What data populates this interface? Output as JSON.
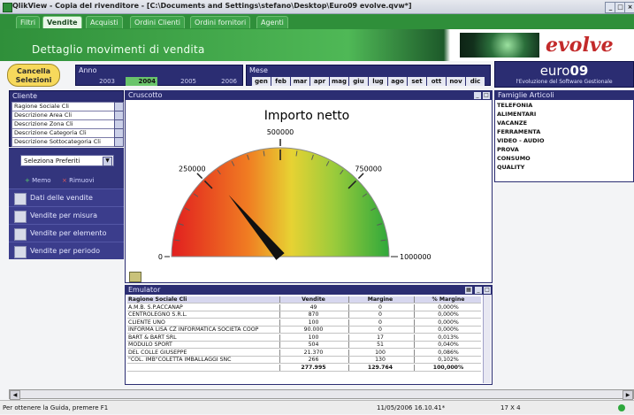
{
  "window": {
    "title": "QlikView - Copia del rivenditore - [C:\\Documents and Settings\\stefano\\Desktop\\Euro09 evolve.qvw*]",
    "buttons": [
      "_",
      "□",
      "×"
    ]
  },
  "tabs": [
    {
      "label": "Filtri",
      "active": false
    },
    {
      "label": "Vendite",
      "active": true
    },
    {
      "label": "Acquisti",
      "active": false
    },
    {
      "label": "Ordini Clienti",
      "active": false
    },
    {
      "label": "Ordini fornitori",
      "active": false
    },
    {
      "label": "Agenti",
      "active": false
    }
  ],
  "header": {
    "page_title": "Dettaglio movimenti di vendita",
    "brand": "evolve"
  },
  "cancel_button": {
    "line1": "Cancella",
    "line2": "Selezioni"
  },
  "anno": {
    "label": "Anno",
    "years": [
      "2003",
      "2004",
      "2005",
      "2006"
    ],
    "selected": "2004"
  },
  "mese": {
    "label": "Mese",
    "months": [
      "gen",
      "feb",
      "mar",
      "apr",
      "mag",
      "giu",
      "lug",
      "ago",
      "set",
      "ott",
      "nov",
      "dic"
    ]
  },
  "euro09": {
    "title_pre": "euro",
    "title_num": "09",
    "subtitle": "l'Evoluzione del Software Gestionale"
  },
  "cliente": {
    "caption": "Cliente",
    "listboxes": [
      "Ragione Sociale Cli",
      "Descrizione Area Cli",
      "Descrizione Zona Cli",
      "Descrizione Categoria Cli",
      "Descrizione Sottocategoria Cli"
    ]
  },
  "preferiti": {
    "select_value": "Seleziona Preferiti",
    "add_label": "Memo",
    "remove_label": "Rimuovi"
  },
  "nav": [
    "Dati delle vendite",
    "Vendite per misura",
    "Vendite per elemento",
    "Vendite per periodo"
  ],
  "cruscotto": {
    "caption": "Cruscotto",
    "gauge_title": "Importo netto",
    "min_label": "0",
    "max_label": "1000000",
    "tick_labels": [
      "250000",
      "500000",
      "750000"
    ],
    "value": 277995,
    "max": 1000000
  },
  "famiglie": {
    "caption": "Famiglie Articoli",
    "items": [
      "TELEFONIA",
      "ALIMENTARI",
      "VACANZE",
      "FERRAMENTA",
      "VIDEO - AUDIO",
      "PROVA",
      "CONSUMO",
      "QUALITY"
    ]
  },
  "table": {
    "caption": "Emulator",
    "headers": [
      "Ragione Sociale Cli",
      "Vendite",
      "Margine",
      "% Margine"
    ],
    "rows": [
      [
        "A.M.B. S.P.ACCANAP",
        "49",
        "0",
        "0,000%"
      ],
      [
        "CENTROLEGNO S.R.L.",
        "870",
        "0",
        "0,000%"
      ],
      [
        "CLIENTE UNO",
        "100",
        "0",
        "0,000%"
      ],
      [
        "INFORMA LISA CZ INFORMATICA SOCIETA COOP",
        "90.000",
        "0",
        "0,000%"
      ],
      [
        "BART & BART SRL",
        "100",
        "17",
        "0,013%"
      ],
      [
        "MODULO SPORT",
        "504",
        "51",
        "0,040%"
      ],
      [
        "DEL COLLE GIUSEPPE",
        "21.370",
        "100",
        "0,086%"
      ],
      [
        "\"COL. IMB\"COLETTA IMBALLAGGI SNC",
        "266",
        "130",
        "0,102%"
      ]
    ],
    "totals": [
      "",
      "277.995",
      "129.764",
      "100,000%"
    ]
  },
  "status": {
    "help": "Per ottenere la Guida, premere F1",
    "datetime": "11/05/2006 16.10.41*",
    "dims": "17 X 4"
  },
  "colors": {
    "green_dark": "#2f8f3a",
    "navy": "#2b2d72",
    "brand_red": "#c32a2a",
    "selected_year": "#69c46b"
  }
}
